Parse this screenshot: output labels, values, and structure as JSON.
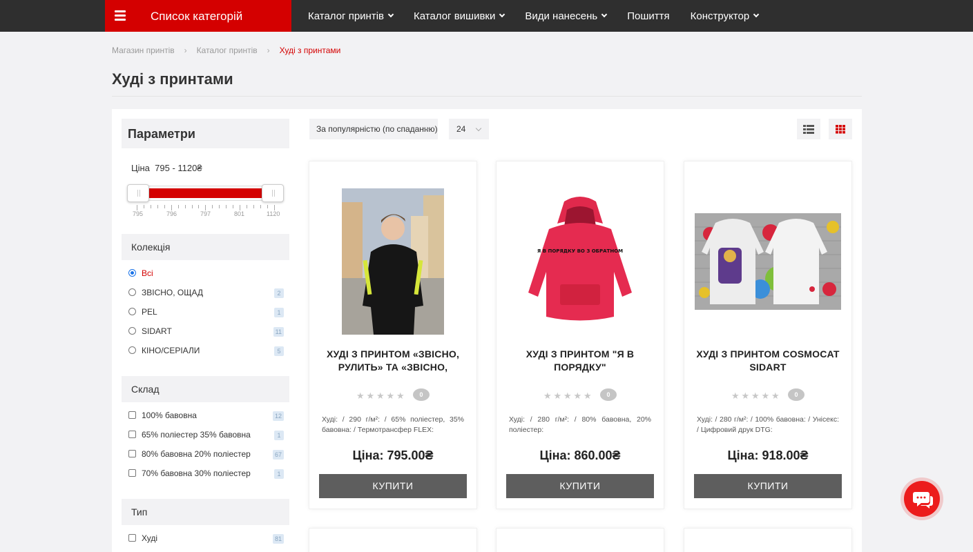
{
  "header": {
    "category_button": "Список категорій",
    "nav": [
      {
        "label": "Каталог принтів",
        "dropdown": true
      },
      {
        "label": "Каталог вишивки",
        "dropdown": true
      },
      {
        "label": "Види нанесень",
        "dropdown": true
      },
      {
        "label": "Пошиття",
        "dropdown": false
      },
      {
        "label": "Конструктор",
        "dropdown": true
      }
    ]
  },
  "breadcrumb": [
    "Магазин принтів",
    "Каталог принтів",
    "Худі з принтами"
  ],
  "page_title": "Худі з принтами",
  "sidebar": {
    "title": "Параметри",
    "price": {
      "label": "Ціна",
      "range": "795 - 1120₴",
      "min": 795,
      "max": 1120,
      "ticks": [
        "795",
        "796",
        "797",
        "801",
        "1120"
      ]
    },
    "collection": {
      "title": "Колекція",
      "options": [
        {
          "label": "Всі",
          "count": "",
          "selected": true
        },
        {
          "label": "ЗВІСНО, ОЩАД",
          "count": "2",
          "selected": false
        },
        {
          "label": "PEL",
          "count": "1",
          "selected": false
        },
        {
          "label": "SIDART",
          "count": "11",
          "selected": false
        },
        {
          "label": "КІНО/СЕРІАЛИ",
          "count": "5",
          "selected": false
        }
      ]
    },
    "composition": {
      "title": "Склад",
      "options": [
        {
          "label": "100% бавовна",
          "count": "12"
        },
        {
          "label": "65% поліестер 35% бавовна",
          "count": "1"
        },
        {
          "label": "80% бавовна 20% поліестер",
          "count": "67"
        },
        {
          "label": "70% бавовна 30% поліестер",
          "count": "1"
        }
      ]
    },
    "type": {
      "title": "Тип",
      "options": [
        {
          "label": "Худі",
          "count": "81"
        }
      ]
    }
  },
  "toolbar": {
    "sort_value": "За популярністю (по спаданню)",
    "per_page_value": "24",
    "view_list_icon": "list-view-icon",
    "view_grid_icon": "grid-view-icon",
    "accent": "#d40000"
  },
  "products": [
    {
      "title": "ХУДІ З ПРИНТОМ «ЗВІСНО, РУЛИТЬ» ТА «ЗВІСНО,",
      "rating_count": "0",
      "desc": "Худі: / 290 г/м²: / 65% поліестер, 35% бавовна: / Термотрансфер FLEX:",
      "price": "Ціна: 795.00₴",
      "buy": "КУПИТИ"
    },
    {
      "title": "ХУДІ З ПРИНТОМ \"Я В ПОРЯДКУ\"",
      "rating_count": "0",
      "desc": "Худі: / 280 г/м²: / 80% бавовна, 20% поліестер:",
      "price": "Ціна: 860.00₴",
      "buy": "КУПИТИ",
      "print_text": "Я В ПОРЯДКУ ВО З ОБРАТНОМ"
    },
    {
      "title": "ХУДІ З ПРИНТОМ COSMOCAT SIDART",
      "rating_count": "0",
      "desc": "Худі: / 280 г/м²: / 100% бавовна: / Унісекс: / Цифровий друк DTG:",
      "price": "Ціна: 918.00₴",
      "buy": "КУПИТИ"
    }
  ],
  "colors": {
    "header_bg": "#2f2f2f",
    "brand_red": "#d40000",
    "button_gray": "#5e5e5e",
    "chat_red": "#ec1c1c"
  }
}
